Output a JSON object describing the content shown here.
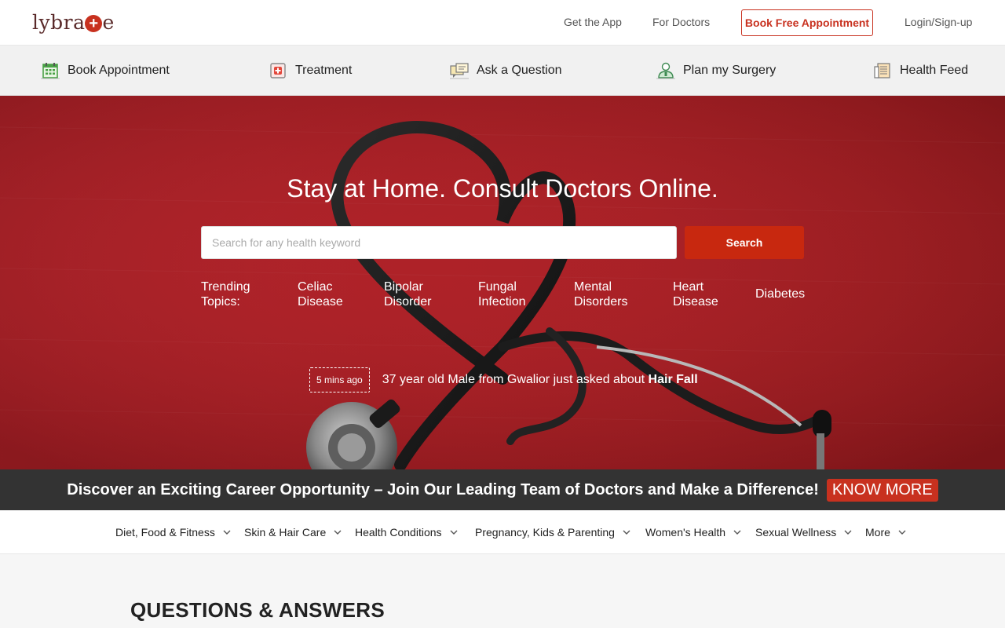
{
  "header": {
    "logo_text_left": "lybra",
    "logo_plus": "+",
    "logo_text_right": "e",
    "get_app": "Get the App",
    "for_doctors": "For Doctors",
    "book_free": "Book Free Appointment",
    "login": "Login/Sign-up"
  },
  "subnav": [
    {
      "label": "Book Appointment",
      "icon": "calendar-icon"
    },
    {
      "label": "Treatment",
      "icon": "first-aid-icon"
    },
    {
      "label": "Ask a Question",
      "icon": "chat-bubble-icon"
    },
    {
      "label": "Plan my Surgery",
      "icon": "doctor-icon"
    },
    {
      "label": "Health Feed",
      "icon": "newspaper-icon"
    }
  ],
  "hero": {
    "title": "Stay at Home. Consult Doctors Online.",
    "search_placeholder": "Search for any health keyword",
    "search_button": "Search",
    "trending_label": [
      "Trending",
      "Topics:"
    ],
    "trending": [
      [
        "Celiac",
        "Disease"
      ],
      [
        "Bipolar",
        "Disorder"
      ],
      [
        "Fungal",
        "Infection"
      ],
      [
        "Mental",
        "Disorders"
      ],
      [
        "Heart",
        "Disease"
      ],
      [
        "Diabetes"
      ]
    ],
    "recent_time": "5 mins ago",
    "recent_text": "37 year old Male from Gwalior just asked about",
    "recent_topic": "Hair Fall"
  },
  "career": {
    "text": "Discover an Exciting Career Opportunity – Join Our Leading Team of Doctors and Make a Difference!",
    "button": "KNOW MORE"
  },
  "categories": [
    "Diet, Food & Fitness",
    "Skin & Hair Care",
    "Health Conditions",
    "Pregnancy, Kids & Parenting",
    "Women's Health",
    "Sexual Wellness",
    "More"
  ],
  "section_title": "QUESTIONS & ANSWERS",
  "colors": {
    "brand_red": "#c8311f",
    "hero_red": "#a81e25",
    "banner_dark": "#333333"
  }
}
